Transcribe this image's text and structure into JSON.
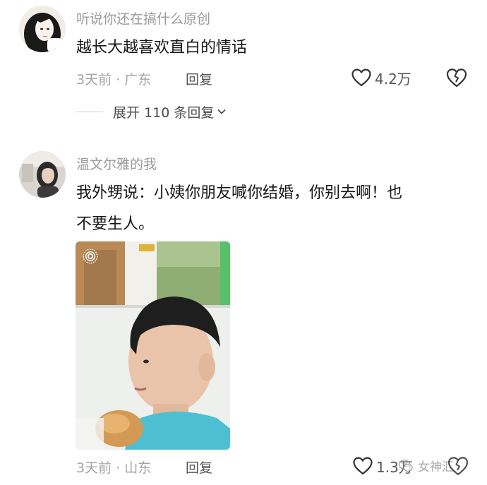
{
  "comments": [
    {
      "username": "听说你还在搞什么原创",
      "content_lines": [
        "越长大越喜欢直白的情话"
      ],
      "time": "3天前",
      "separator": "·",
      "location": "广东",
      "reply_label": "回复",
      "likes": "4.2万",
      "expand_label": "展开 110 条回复"
    },
    {
      "username": "温文尔雅的我",
      "content_lines": [
        "我外甥说：小姨你朋友喊你结婚，你别去啊！也",
        "不要生人。"
      ],
      "time": "3天前",
      "separator": "·",
      "location": "山东",
      "reply_label": "回复",
      "likes": "1.3万"
    }
  ],
  "watermark": {
    "text": "女神汇",
    "icon": "wechat-icon"
  },
  "icons": {
    "like": "heart-outline-icon",
    "dislike": "broken-heart-icon",
    "expand": "chevron-down-icon",
    "live_photo": "live-photo-icon"
  }
}
